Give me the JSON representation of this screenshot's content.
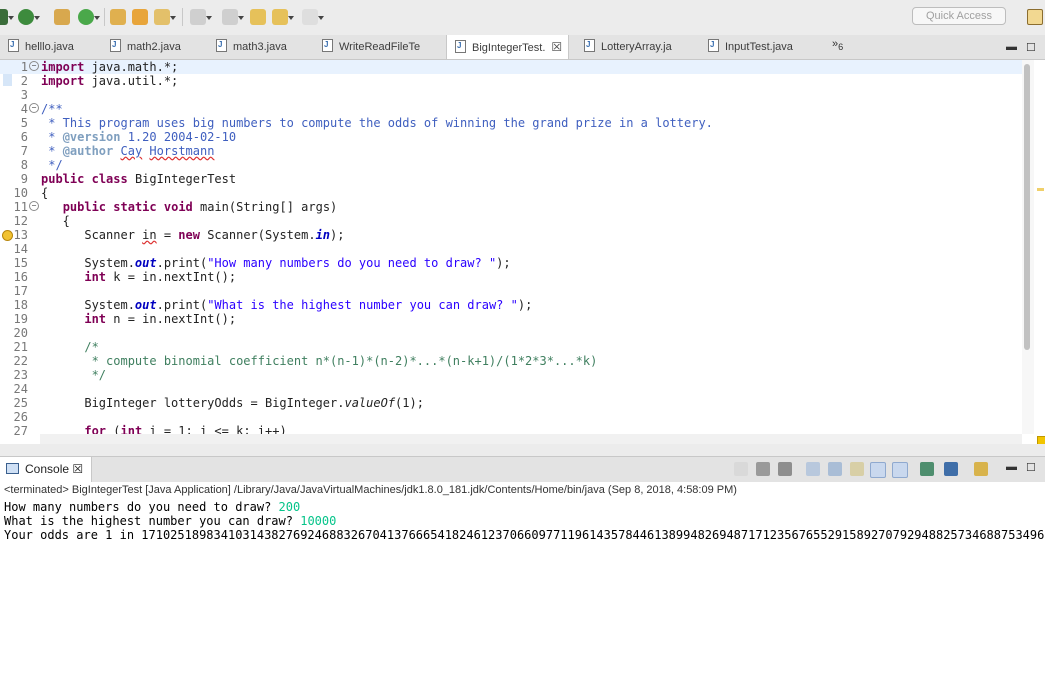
{
  "toolbar": {
    "quick_access_placeholder": "Quick Access"
  },
  "editor_tabs": {
    "tabs": [
      {
        "label": "helllo.java"
      },
      {
        "label": "math2.java"
      },
      {
        "label": "math3.java"
      },
      {
        "label": "WriteReadFileTe"
      },
      {
        "label": "BigIntegerTest.",
        "active": true,
        "close": "☒"
      },
      {
        "label": "LotteryArray.ja"
      },
      {
        "label": "InputTest.java"
      }
    ],
    "overflow_label": "»",
    "overflow_count": "6"
  },
  "editor": {
    "line_numbers": [
      "1",
      "2",
      "3",
      "4",
      "5",
      "6",
      "7",
      "8",
      "9",
      "10",
      "11",
      "12",
      "13",
      "14",
      "15",
      "16",
      "17",
      "18",
      "19",
      "20",
      "21",
      "22",
      "23",
      "24",
      "25",
      "26",
      "27"
    ],
    "code": {
      "l1_kw": "import",
      "l1_rest": " java.math.*;",
      "l2_kw": "import",
      "l2_rest": " java.util.*;",
      "l4": "/**",
      "l5": " * This program uses big numbers to compute the odds of winning the grand prize in a lottery.",
      "l6_pre": " * ",
      "l6_tag": "@version",
      "l6_rest": " 1.20 2004-02-10",
      "l7_pre": " * ",
      "l7_tag": "@author",
      "l7_sp": " ",
      "l7_n1": "Cay",
      "l7_sp2": " ",
      "l7_n2": "Horstmann",
      "l8": " */",
      "l9_kw1": "public",
      "l9_sp": " ",
      "l9_kw2": "class",
      "l9_rest": " BigIntegerTest",
      "l10": "{",
      "l11_ind": "   ",
      "l11_kw1": "public",
      "l11_sp1": " ",
      "l11_kw2": "static",
      "l11_sp2": " ",
      "l11_kw3": "void",
      "l11_rest": " main(String[] args)",
      "l12": "   {",
      "l13_a": "      Scanner ",
      "l13_var": "in",
      "l13_b": " = ",
      "l13_kw": "new",
      "l13_c": " Scanner(System.",
      "l13_st": "in",
      "l13_d": ");",
      "l15_a": "      System.",
      "l15_st": "out",
      "l15_b": ".print(",
      "l15_str": "\"How many numbers do you need to draw? \"",
      "l15_c": ");",
      "l16_ind": "      ",
      "l16_kw": "int",
      "l16_rest": " k = in.nextInt();",
      "l18_a": "      System.",
      "l18_st": "out",
      "l18_b": ".print(",
      "l18_str": "\"What is the highest number you can draw? \"",
      "l18_c": ");",
      "l19_ind": "      ",
      "l19_kw": "int",
      "l19_rest": " n = in.nextInt();",
      "l21": "      /*",
      "l22": "       * compute binomial coefficient n*(n-1)*(n-2)*...*(n-k+1)/(1*2*3*...*k)",
      "l23": "       */",
      "l25_a": "      BigInteger ",
      "l25_var": "lotteryOdds",
      "l25_b": " = BigInteger.",
      "l25_m": "valueOf",
      "l25_c": "(1);",
      "l27_ind": "      ",
      "l27_kw1": "for",
      "l27_a": " (",
      "l27_kw2": "int",
      "l27_b": " i = 1; i <= k; i++)"
    }
  },
  "console": {
    "tab_label": "Console",
    "tab_close": "☒",
    "status": "<terminated> BigIntegerTest [Java Application] /Library/Java/JavaVirtualMachines/jdk1.8.0_181.jdk/Contents/Home/bin/java (Sep 8, 2018, 4:58:09 PM)",
    "line1_prompt": "How many numbers do you need to draw? ",
    "line1_input": "200",
    "line2_prompt": "What is the highest number you can draw? ",
    "line2_input": "10000",
    "line3": "Your odds are 1 in 17102518983410314382769246883267041376665418246123706609771196143578446138994826948717123567655291589270792948825734688753496"
  },
  "colors": {
    "keyword": "#7f0055",
    "comment": "#3f7f5f",
    "javadoc": "#3f5fbf",
    "string": "#2a00ff",
    "console_input": "#06c48a"
  },
  "icons": [
    "debug-icon",
    "run-icon",
    "new-package-icon",
    "run-last-icon",
    "open-type-icon",
    "open-folder-icon",
    "search-icon",
    "next-annotation-icon",
    "prev-annotation-icon",
    "back-icon",
    "forward-icon",
    "perspective-icon",
    "java-file-icon",
    "console-icon",
    "terminate-icon",
    "remove-launch-icon",
    "clear-console-icon",
    "scroll-lock-icon",
    "word-wrap-icon",
    "pin-console-icon",
    "display-console-icon",
    "new-console-icon",
    "minimize-icon",
    "maximize-icon",
    "warning-icon",
    "fold-icon"
  ]
}
